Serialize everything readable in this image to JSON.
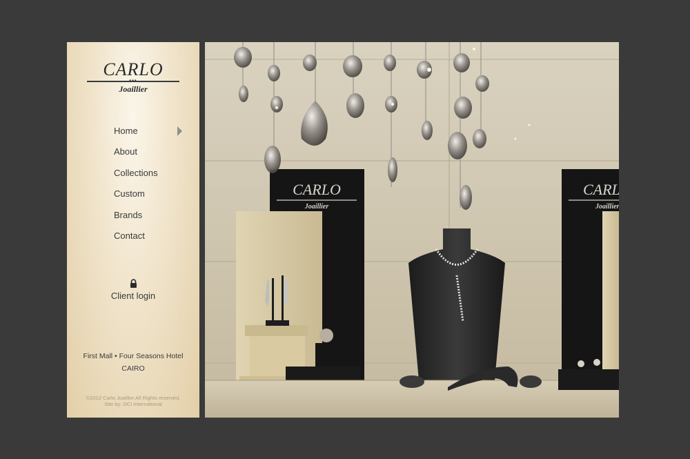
{
  "logo": {
    "brand": "CARLO",
    "dots": "•••",
    "sub": "Joaillier"
  },
  "nav": {
    "items": [
      {
        "label": "Home"
      },
      {
        "label": "About"
      },
      {
        "label": "Collections"
      },
      {
        "label": "Custom"
      },
      {
        "label": "Brands"
      },
      {
        "label": "Contact"
      }
    ]
  },
  "login": {
    "label": "Client login",
    "icon": "lock-icon"
  },
  "address": {
    "line1": "First Mall • Four Seasons Hotel",
    "line2": "CAIRO"
  },
  "footer": {
    "copyright": "©2012 Carlo Joaillier.All Rights reserved.",
    "credit": "Site by: DCI International"
  },
  "photo": {
    "sign_brand": "CARLO",
    "sign_sub": "Joaillier"
  },
  "colors": {
    "background": "#3a3a3a",
    "sidebar": "#f1e5cd",
    "text": "#3a3a3a",
    "arrow": "#8f8f8f"
  }
}
